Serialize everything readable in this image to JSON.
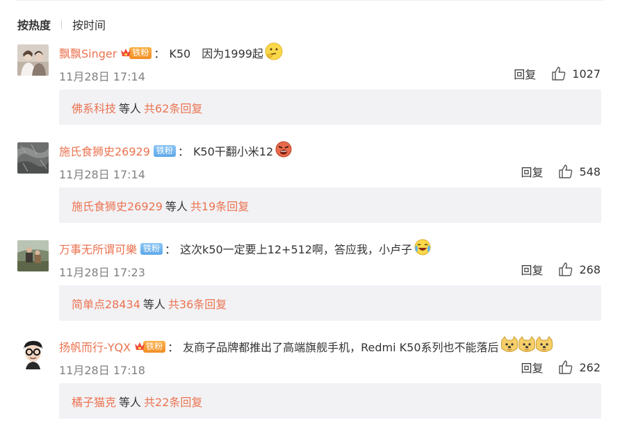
{
  "sort": {
    "hot": "按热度",
    "time": "按时间"
  },
  "comments": [
    {
      "user": "飘飘Singer",
      "badge": "铁粉",
      "badge_style": "gold",
      "text": "K50　因为1999起",
      "emoji": "thinking-emoji",
      "time": "11月28日 17:14",
      "reply": "回复",
      "likes": "1027",
      "sub_user": "佛系科技",
      "sub_mid": "等人",
      "sub_count": "共62条回复"
    },
    {
      "user": "施氏食狮史26929",
      "badge": "铁粉",
      "badge_style": "blue",
      "text": "K50干翻小米12",
      "emoji": "angry-emoji",
      "time": "11月28日 17:14",
      "reply": "回复",
      "likes": "548",
      "sub_user": "施氏食狮史26929",
      "sub_mid": "等人",
      "sub_count": "共19条回复"
    },
    {
      "user": "万事无所谓可樂",
      "badge": "铁粉",
      "badge_style": "blue",
      "text": "这次k50一定要上12+512啊，答应我，小卢子",
      "emoji": "crying-laugh-emoji",
      "time": "11月28日 17:23",
      "reply": "回复",
      "likes": "268",
      "sub_user": "简单点28434",
      "sub_mid": "等人",
      "sub_count": "共36条回复"
    },
    {
      "user": "扬帆而行-YQX",
      "badge": "铁粉",
      "badge_style": "gold",
      "text": "友商子品牌都推出了高端旗舰手机，Redmi K50系列也不能落后",
      "emoji": "doge-emoji",
      "time": "11月28日 17:18",
      "reply": "回复",
      "likes": "262",
      "sub_user": "橘子猫克",
      "sub_mid": "等人",
      "sub_count": "共22条回复"
    }
  ],
  "colors": {
    "username": "#eb7350",
    "time": "#808080",
    "sub_bg": "#f2f2f5",
    "gold_badge": "#f38d25",
    "blue_badge": "#5ea8e8"
  }
}
